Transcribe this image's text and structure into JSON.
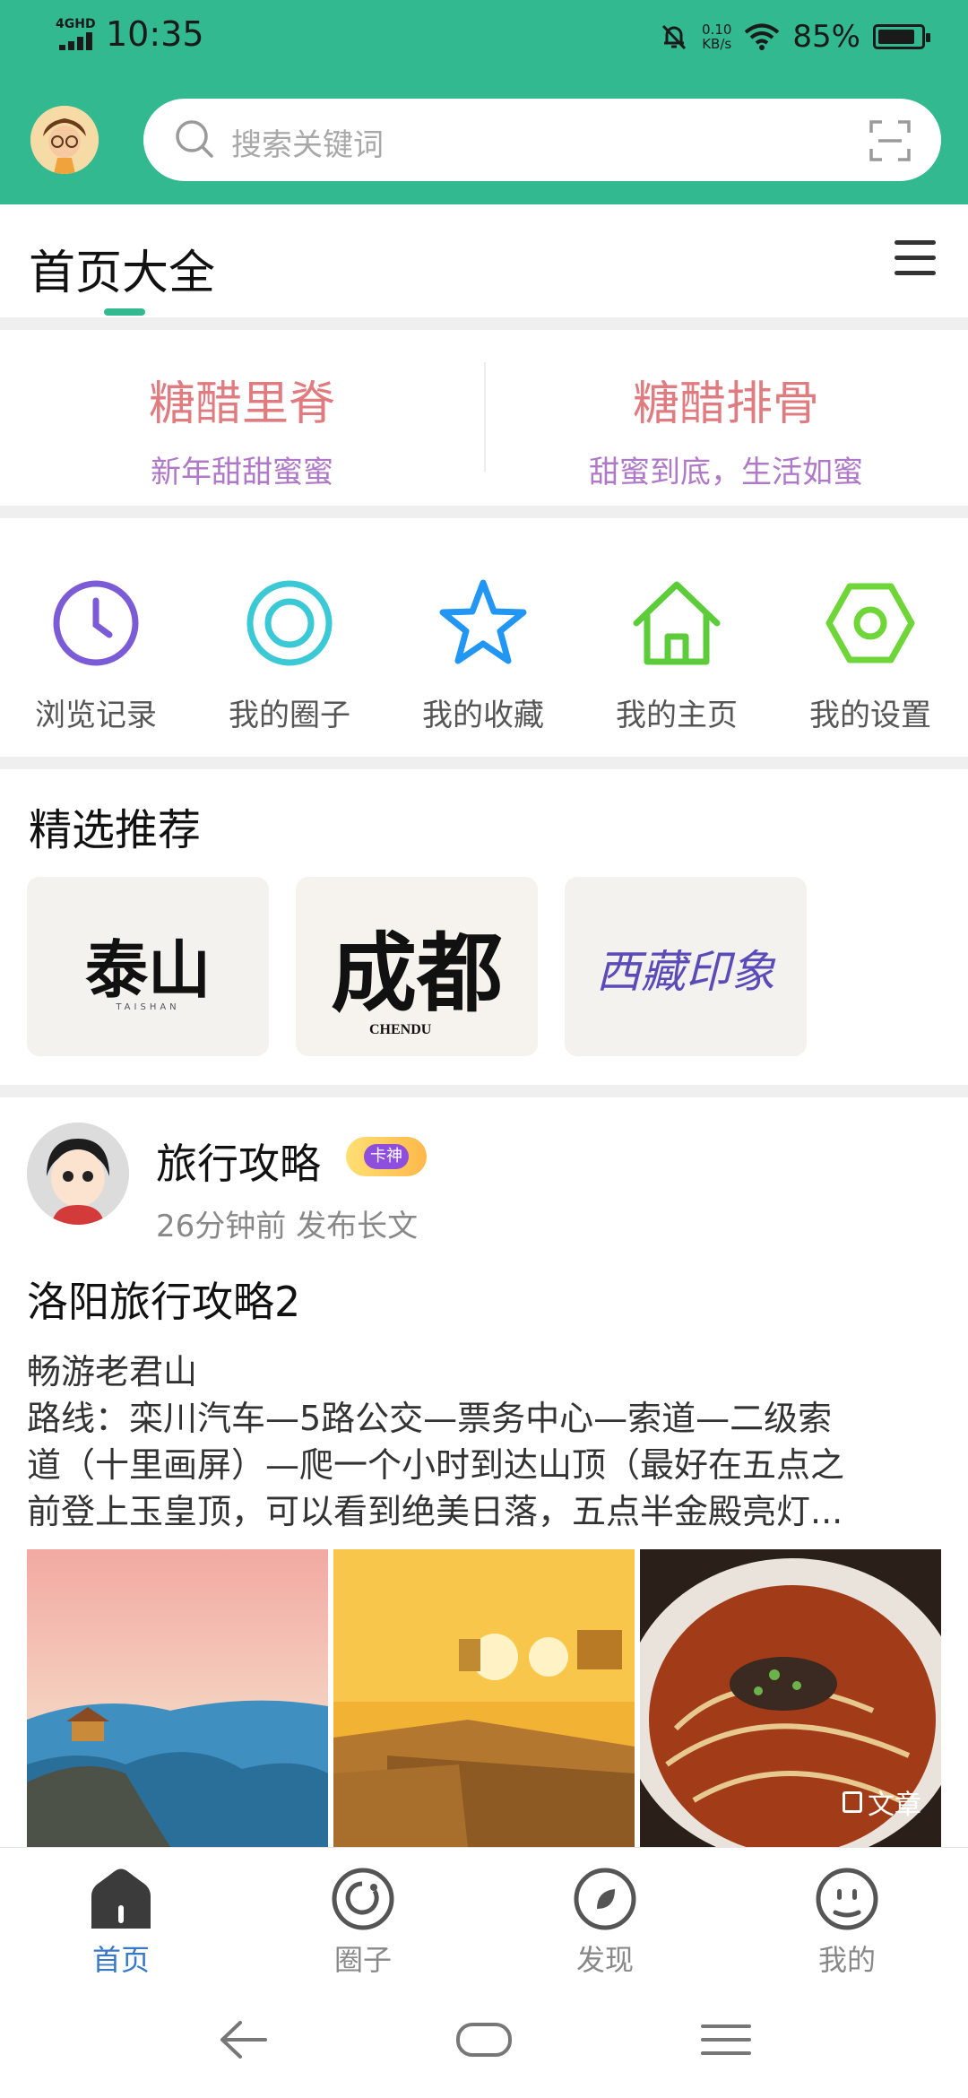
{
  "status_bar": {
    "network": "4GHD",
    "time": "10:35",
    "speed_value": "0.10",
    "speed_unit": "KB/s",
    "battery": "85%"
  },
  "header": {
    "search_placeholder": "搜索关键词"
  },
  "tab_header": {
    "title": "首页大全"
  },
  "promos": [
    {
      "title": "糖醋里脊",
      "subtitle": "新年甜甜蜜蜜"
    },
    {
      "title": "糖醋排骨",
      "subtitle": "甜蜜到底，生活如蜜"
    }
  ],
  "quick_actions": [
    {
      "label": "浏览记录",
      "icon": "clock-icon",
      "color": "#7b5cd6"
    },
    {
      "label": "我的圈子",
      "icon": "circle-ring-icon",
      "color": "#3cc9d6"
    },
    {
      "label": "我的收藏",
      "icon": "star-icon",
      "color": "#2196f3"
    },
    {
      "label": "我的主页",
      "icon": "home-icon",
      "color": "#5ccc3a"
    },
    {
      "label": "我的设置",
      "icon": "hexagon-gear-icon",
      "color": "#6fd63a"
    }
  ],
  "featured": {
    "heading": "精选推荐",
    "cards": [
      {
        "art": "泰山",
        "sub": "TAISHAN"
      },
      {
        "art": "成都",
        "sub": "CHENDU"
      },
      {
        "art": "西藏印象",
        "sub": ""
      }
    ]
  },
  "post": {
    "author": "旅行攻略",
    "badge": "卡神",
    "meta": "26分钟前  发布长文",
    "title": "洛阳旅行攻略2",
    "lines": [
      "畅游老君山",
      "路线：栾川汽车—5路公交—票务中心—索道—二级索",
      "道（十里画屏）—爬一个小时到达山顶（最好在五点之",
      "前登上玉皇顶，可以看到绝美日落，五点半金殿亮灯..."
    ],
    "article_badge": "文章"
  },
  "bottom_nav": [
    {
      "label": "首页",
      "icon": "home-filled-icon"
    },
    {
      "label": "圈子",
      "icon": "circle-icon"
    },
    {
      "label": "发现",
      "icon": "discover-icon"
    },
    {
      "label": "我的",
      "icon": "smile-face-icon"
    }
  ],
  "colors": {
    "brand_green": "#33b990",
    "promo_title": "#e07b80",
    "promo_subtitle": "#b079c8",
    "active_nav": "#3878c7"
  }
}
